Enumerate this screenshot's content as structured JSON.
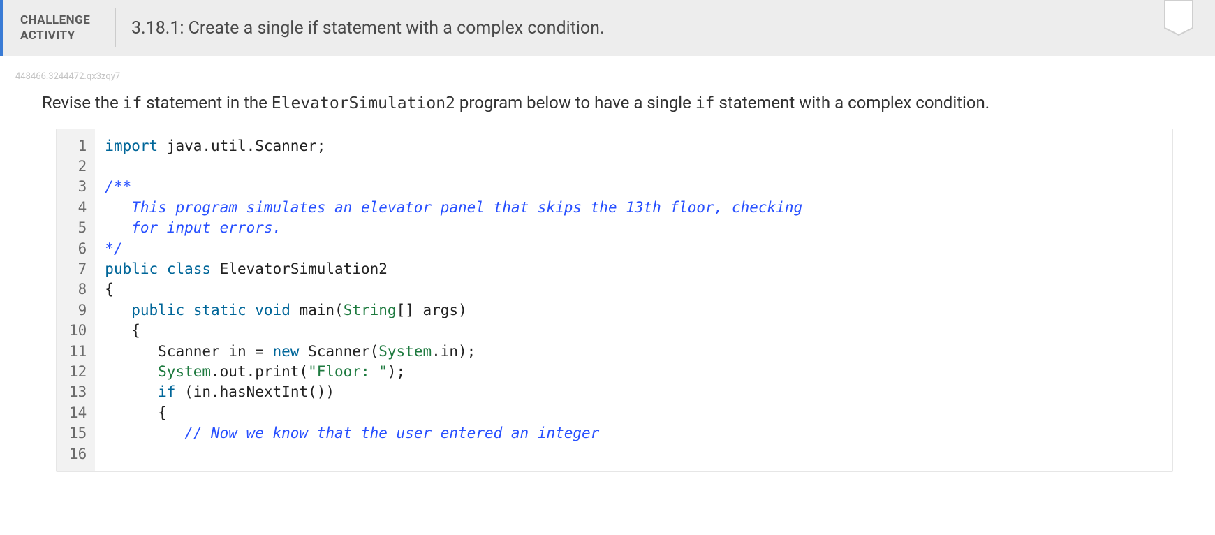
{
  "header": {
    "label_line1": "CHALLENGE",
    "label_line2": "ACTIVITY",
    "title": "3.18.1: Create a single if statement with a complex condition."
  },
  "tiny_id": "448466.3244472.qx3zqy7",
  "instructions": {
    "p1": "Revise the ",
    "code1": "if",
    "p2": " statement in the ",
    "code2": "ElevatorSimulation2",
    "p3": " program below to have a single ",
    "code3": "if",
    "p4": " statement with a complex condition."
  },
  "code": {
    "line_count": 16,
    "tokens": [
      [
        {
          "t": "keyword",
          "v": "import"
        },
        {
          "t": "plain",
          "v": " java.util.Scanner;"
        }
      ],
      [],
      [
        {
          "t": "comment",
          "v": "/**"
        }
      ],
      [
        {
          "t": "comment",
          "v": "   This program simulates an elevator panel that skips the 13th floor, checking"
        }
      ],
      [
        {
          "t": "comment",
          "v": "   for input errors."
        }
      ],
      [
        {
          "t": "comment",
          "v": "*/"
        }
      ],
      [
        {
          "t": "keyword",
          "v": "public"
        },
        {
          "t": "plain",
          "v": " "
        },
        {
          "t": "keyword",
          "v": "class"
        },
        {
          "t": "plain",
          "v": " ElevatorSimulation2"
        }
      ],
      [
        {
          "t": "plain",
          "v": "{"
        }
      ],
      [
        {
          "t": "plain",
          "v": "   "
        },
        {
          "t": "keyword",
          "v": "public"
        },
        {
          "t": "plain",
          "v": " "
        },
        {
          "t": "keyword",
          "v": "static"
        },
        {
          "t": "plain",
          "v": " "
        },
        {
          "t": "keyword",
          "v": "void"
        },
        {
          "t": "plain",
          "v": " main("
        },
        {
          "t": "type",
          "v": "String"
        },
        {
          "t": "plain",
          "v": "[] args)"
        }
      ],
      [
        {
          "t": "plain",
          "v": "   {"
        }
      ],
      [
        {
          "t": "plain",
          "v": "      Scanner in = "
        },
        {
          "t": "keyword",
          "v": "new"
        },
        {
          "t": "plain",
          "v": " Scanner("
        },
        {
          "t": "type",
          "v": "System"
        },
        {
          "t": "plain",
          "v": ".in);"
        }
      ],
      [
        {
          "t": "plain",
          "v": "      "
        },
        {
          "t": "type",
          "v": "System"
        },
        {
          "t": "plain",
          "v": ".out.print("
        },
        {
          "t": "string",
          "v": "\"Floor: \""
        },
        {
          "t": "plain",
          "v": ");"
        }
      ],
      [
        {
          "t": "plain",
          "v": "      "
        },
        {
          "t": "keyword",
          "v": "if"
        },
        {
          "t": "plain",
          "v": " (in.hasNextInt())"
        }
      ],
      [
        {
          "t": "plain",
          "v": "      {"
        }
      ],
      [
        {
          "t": "plain",
          "v": "         "
        },
        {
          "t": "comment",
          "v": "// Now we know that the user entered an integer"
        }
      ],
      []
    ]
  }
}
